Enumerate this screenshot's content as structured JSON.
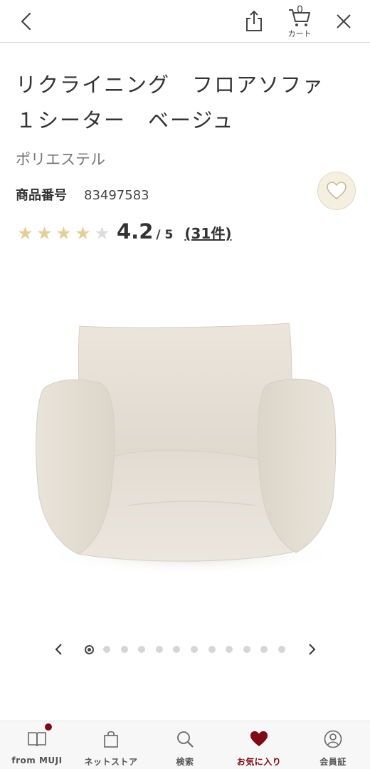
{
  "header": {
    "cart_count": "0",
    "cart_label": "カート"
  },
  "product": {
    "title_line1": "リクライニング　フロアソファ",
    "title_line2": "１シーター　ベージュ",
    "material": "ポリエステル",
    "product_no_label": "商品番号",
    "product_no": "83497583",
    "rating": "4.2",
    "rating_max": "/ 5",
    "rating_stars_filled": 4,
    "rating_stars_total": 5,
    "review_count": "(31件)"
  },
  "carousel": {
    "total_images": 12,
    "current_index": 1
  },
  "nav": {
    "items": [
      {
        "label": "from MUJI",
        "icon": "book-icon"
      },
      {
        "label": "ネットストア",
        "icon": "shopping-bag-icon"
      },
      {
        "label": "検索",
        "icon": "search-icon"
      },
      {
        "label": "お気に入り",
        "icon": "heart-icon"
      },
      {
        "label": "会員証",
        "icon": "member-icon"
      }
    ],
    "active": "お気に入り"
  },
  "colors": {
    "accent": "#7c0a17",
    "star": "#e4ce99",
    "favorite_button_bg": "#f4efe1"
  }
}
